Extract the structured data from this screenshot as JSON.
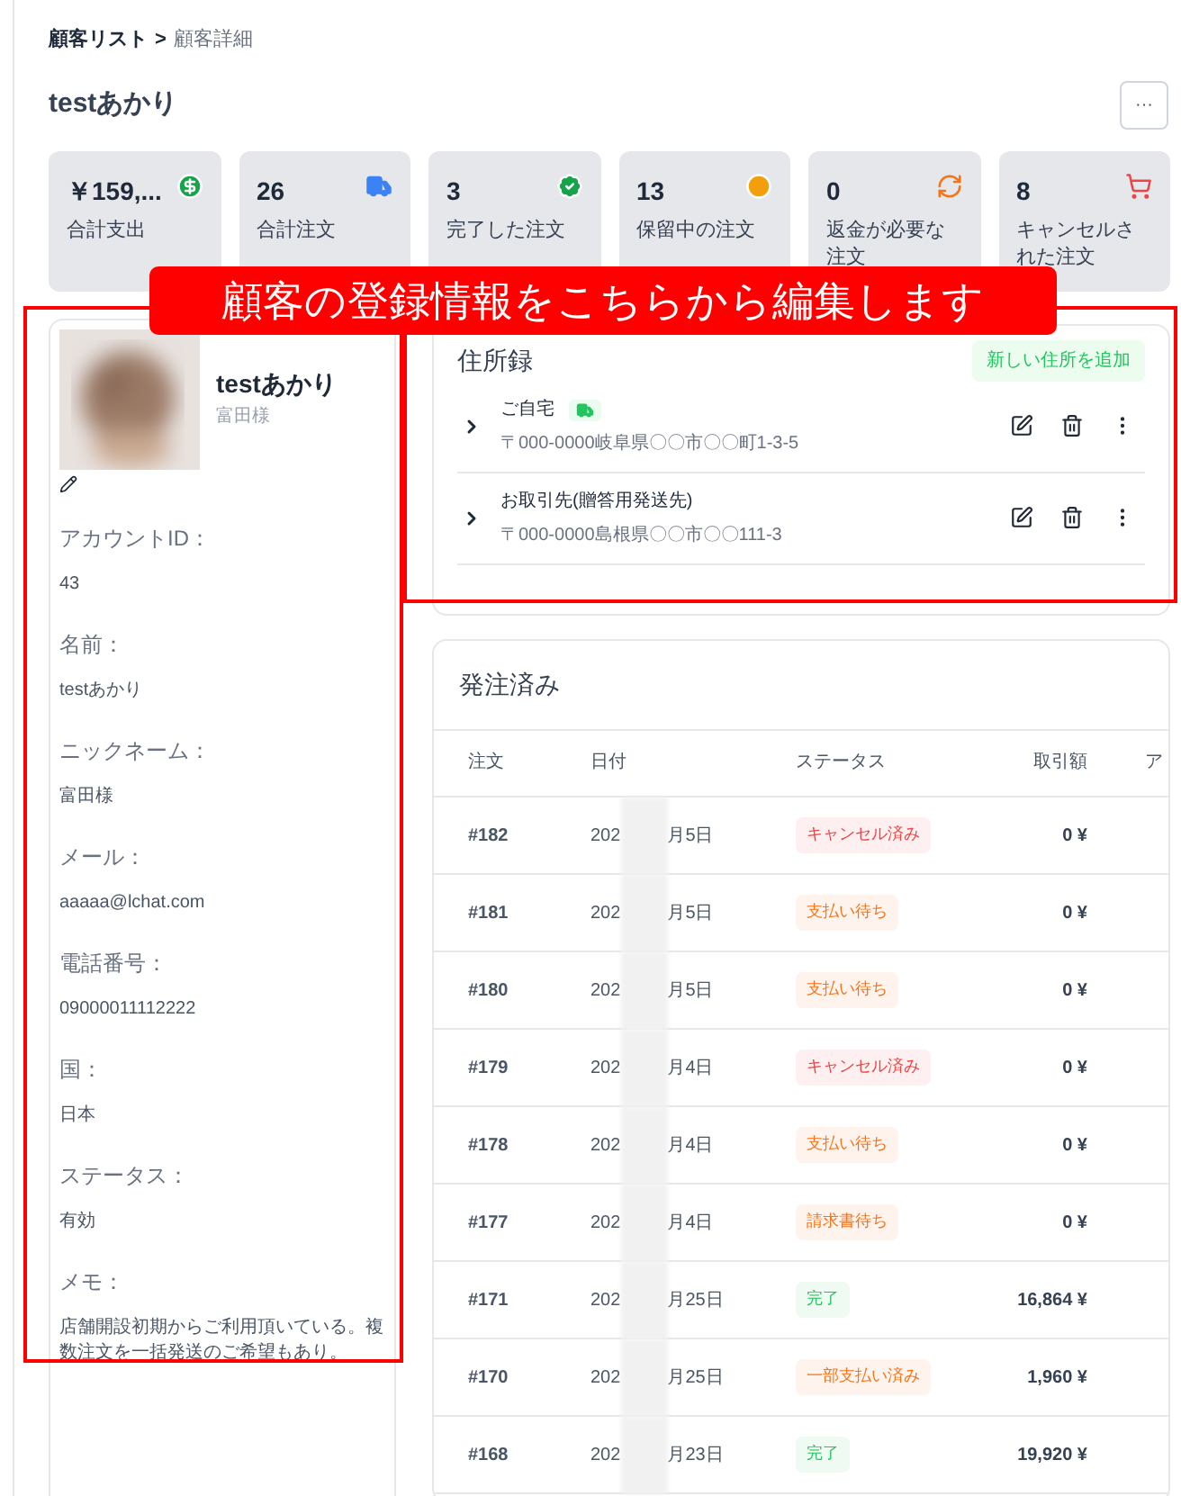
{
  "breadcrumb": [
    {
      "label": "顧客リスト",
      "current": false
    },
    {
      "label": ">",
      "current": false
    },
    {
      "label": "顧客詳細",
      "current": true
    }
  ],
  "title": "testあかり",
  "more_button": "···",
  "stats": [
    {
      "kind": "spend",
      "value": "￥159,...",
      "label": "合計支出"
    },
    {
      "kind": "orders",
      "value": "26",
      "label": "合計注文"
    },
    {
      "kind": "completed",
      "value": "3",
      "label": "完了した注文"
    },
    {
      "kind": "pending",
      "value": "13",
      "label": "保留中の注文"
    },
    {
      "kind": "refund",
      "value": "0",
      "label": "返金が必要な注文"
    },
    {
      "kind": "cancelled",
      "value": "8",
      "label": "キャンセルされた注文"
    }
  ],
  "profile": {
    "name": "testあかり",
    "nickname": "富田様",
    "fields": [
      {
        "label": "アカウントID：",
        "value": "43"
      },
      {
        "label": "名前：",
        "value": "testあかり"
      },
      {
        "label": "ニックネーム：",
        "value": "富田様"
      },
      {
        "label": "メール：",
        "value": "aaaaa@lchat.com"
      },
      {
        "label": "電話番号：",
        "value": "09000011112222"
      },
      {
        "label": "国：",
        "value": "日本"
      },
      {
        "label": "ステータス：",
        "value": "有効"
      },
      {
        "label": "メモ：",
        "value": "店舗開設初期からご利用頂いている。複数注文を一括発送のご希望もあり。"
      }
    ]
  },
  "address_book": {
    "title": "住所録",
    "add_button": "新しい住所を追加",
    "addresses": [
      {
        "name": "ご自宅",
        "default_shipping": true,
        "address": "〒000-0000岐阜県〇〇市〇〇町1-3-5"
      },
      {
        "name": "お取引先(贈答用発送先)",
        "default_shipping": false,
        "address": "〒000-0000島根県〇〇市〇〇111-3"
      }
    ]
  },
  "orders": {
    "title": "発注済み",
    "columns": [
      "注文",
      "日付",
      "ステータス",
      "取引額",
      "ア"
    ],
    "rows": [
      {
        "order": "#182",
        "date_start": "202",
        "date_end": "月5日",
        "status": "キャンセル済み",
        "color": "#ef4444",
        "amount": "0 ¥"
      },
      {
        "order": "#181",
        "date_start": "202",
        "date_end": "月5日",
        "status": "支払い待ち",
        "color": "#f97316",
        "amount": "0 ¥"
      },
      {
        "order": "#180",
        "date_start": "202",
        "date_end": "月5日",
        "status": "支払い待ち",
        "color": "#f97316",
        "amount": "0 ¥"
      },
      {
        "order": "#179",
        "date_start": "202",
        "date_end": "月4日",
        "status": "キャンセル済み",
        "color": "#ef4444",
        "amount": "0 ¥"
      },
      {
        "order": "#178",
        "date_start": "202",
        "date_end": "月4日",
        "status": "支払い待ち",
        "color": "#f97316",
        "amount": "0 ¥"
      },
      {
        "order": "#177",
        "date_start": "202",
        "date_end": "月4日",
        "status": "請求書待ち",
        "color": "#f97316",
        "amount": "0 ¥"
      },
      {
        "order": "#171",
        "date_start": "202",
        "date_end": "月25日",
        "status": "完了",
        "color": "#22c55e",
        "amount": "16,864 ¥"
      },
      {
        "order": "#170",
        "date_start": "202",
        "date_end": "月25日",
        "status": "一部支払い済み",
        "color": "#f97316",
        "amount": "1,960 ¥"
      },
      {
        "order": "#168",
        "date_start": "202",
        "date_end": "月23日",
        "status": "完了",
        "color": "#22c55e",
        "amount": "19,920 ¥"
      }
    ]
  },
  "annotation": {
    "callout": "顧客の登録情報をこちらから編集します"
  }
}
